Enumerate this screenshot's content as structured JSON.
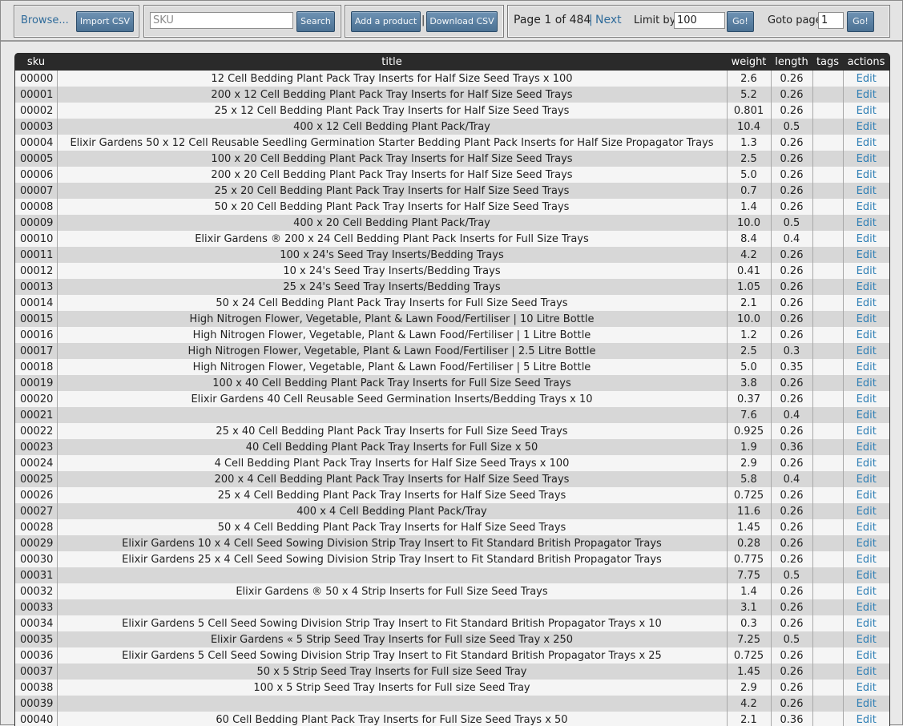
{
  "toolbar": {
    "browse_label": "Browse...",
    "import_label": "Import CSV",
    "sku_placeholder": "SKU",
    "search_label": "Search",
    "add_product_label": "Add a product",
    "separator": "|",
    "download_label": "Download CSV",
    "page_info": "Page 1 of 484",
    "page_sep": "|",
    "next_label": "Next",
    "limit_label": "Limit by",
    "limit_value": "100",
    "limit_go": "Go!",
    "goto_label": "Goto page",
    "goto_value": "1",
    "goto_go": "Go!"
  },
  "table": {
    "headers": [
      "sku",
      "title",
      "weight",
      "length",
      "tags",
      "actions"
    ],
    "action_label": "Edit",
    "rows": [
      [
        "00000",
        "12 Cell Bedding Plant Pack Tray Inserts for Half Size Seed Trays x 100",
        "2.6",
        "0.26",
        ""
      ],
      [
        "00001",
        "200 x 12 Cell Bedding Plant Pack Tray Inserts for Half Size Seed Trays",
        "5.2",
        "0.26",
        ""
      ],
      [
        "00002",
        "25 x 12 Cell Bedding Plant Pack Tray Inserts for Half Size Seed Trays",
        "0.801",
        "0.26",
        ""
      ],
      [
        "00003",
        "400 x 12 Cell Bedding Plant Pack/Tray",
        "10.4",
        "0.5",
        ""
      ],
      [
        "00004",
        "Elixir Gardens 50 x 12 Cell Reusable Seedling Germination Starter Bedding Plant Pack Inserts for Half Size Propagator Trays",
        "1.3",
        "0.26",
        ""
      ],
      [
        "00005",
        "100 x 20 Cell Bedding Plant Pack Tray Inserts for Half Size Seed Trays",
        "2.5",
        "0.26",
        ""
      ],
      [
        "00006",
        "200 x 20 Cell Bedding Plant Pack Tray Inserts for Half Size Seed Trays",
        "5.0",
        "0.26",
        ""
      ],
      [
        "00007",
        "25 x 20 Cell Bedding Plant Pack Tray Inserts for Half Size Seed Trays",
        "0.7",
        "0.26",
        ""
      ],
      [
        "00008",
        "50 x 20 Cell Bedding Plant Pack Tray Inserts for Half Size Seed Trays",
        "1.4",
        "0.26",
        ""
      ],
      [
        "00009",
        "400 x 20 Cell Bedding Plant Pack/Tray",
        "10.0",
        "0.5",
        ""
      ],
      [
        "00010",
        "Elixir Gardens ® 200 x 24 Cell Bedding Plant Pack Inserts for Full Size Trays",
        "8.4",
        "0.4",
        ""
      ],
      [
        "00011",
        "100 x 24's Seed Tray Inserts/Bedding Trays",
        "4.2",
        "0.26",
        ""
      ],
      [
        "00012",
        "10 x 24's Seed Tray Inserts/Bedding Trays",
        "0.41",
        "0.26",
        ""
      ],
      [
        "00013",
        "25 x 24's Seed Tray Inserts/Bedding Trays",
        "1.05",
        "0.26",
        ""
      ],
      [
        "00014",
        "50 x 24 Cell Bedding Plant Pack Tray Inserts for Full Size Seed Trays",
        "2.1",
        "0.26",
        ""
      ],
      [
        "00015",
        "High Nitrogen Flower, Vegetable, Plant & Lawn Food/Fertiliser | 10 Litre Bottle",
        "10.0",
        "0.26",
        ""
      ],
      [
        "00016",
        "High Nitrogen Flower, Vegetable, Plant & Lawn Food/Fertiliser | 1 Litre Bottle",
        "1.2",
        "0.26",
        ""
      ],
      [
        "00017",
        "High Nitrogen Flower, Vegetable, Plant & Lawn Food/Fertiliser | 2.5 Litre Bottle",
        "2.5",
        "0.3",
        ""
      ],
      [
        "00018",
        "High Nitrogen Flower, Vegetable, Plant & Lawn Food/Fertiliser | 5 Litre Bottle",
        "5.0",
        "0.35",
        ""
      ],
      [
        "00019",
        "100 x 40 Cell Bedding Plant Pack Tray Inserts for Full Size Seed Trays",
        "3.8",
        "0.26",
        ""
      ],
      [
        "00020",
        "Elixir Gardens 40 Cell Reusable Seed Germination Inserts/Bedding Trays x 10",
        "0.37",
        "0.26",
        ""
      ],
      [
        "00021",
        "",
        "7.6",
        "0.4",
        ""
      ],
      [
        "00022",
        "25 x 40 Cell Bedding Plant Pack Tray Inserts for Full Size Seed Trays",
        "0.925",
        "0.26",
        ""
      ],
      [
        "00023",
        "40 Cell Bedding Plant Pack Tray Inserts for Full Size x 50",
        "1.9",
        "0.36",
        ""
      ],
      [
        "00024",
        "4 Cell Bedding Plant Pack Tray Inserts for Half Size Seed Trays x 100",
        "2.9",
        "0.26",
        ""
      ],
      [
        "00025",
        "200 x 4 Cell Bedding Plant Pack Tray Inserts for Half Size Seed Trays",
        "5.8",
        "0.4",
        ""
      ],
      [
        "00026",
        "25 x 4 Cell Bedding Plant Pack Tray Inserts for Half Size Seed Trays",
        "0.725",
        "0.26",
        ""
      ],
      [
        "00027",
        "400 x 4 Cell Bedding Plant Pack/Tray",
        "11.6",
        "0.26",
        ""
      ],
      [
        "00028",
        "50 x 4 Cell Bedding Plant Pack Tray Inserts for Half Size Seed Trays",
        "1.45",
        "0.26",
        ""
      ],
      [
        "00029",
        "Elixir Gardens 10 x 4 Cell Seed Sowing Division Strip Tray Insert to Fit Standard British Propagator Trays",
        "0.28",
        "0.26",
        ""
      ],
      [
        "00030",
        "Elixir Gardens 25 x 4 Cell Seed Sowing Division Strip Tray Insert to Fit Standard British Propagator Trays",
        "0.775",
        "0.26",
        ""
      ],
      [
        "00031",
        "",
        "7.75",
        "0.5",
        ""
      ],
      [
        "00032",
        "Elixir Gardens ® 50 x 4 Strip Inserts for Full Size Seed Trays",
        "1.4",
        "0.26",
        ""
      ],
      [
        "00033",
        "",
        "3.1",
        "0.26",
        ""
      ],
      [
        "00034",
        "Elixir Gardens 5 Cell Seed Sowing Division Strip Tray Insert to Fit Standard British Propagator Trays x 10",
        "0.3",
        "0.26",
        ""
      ],
      [
        "00035",
        "Elixir Gardens « 5 Strip Seed Tray Inserts for Full size Seed Tray x 250",
        "7.25",
        "0.5",
        ""
      ],
      [
        "00036",
        "Elixir Gardens 5 Cell Seed Sowing Division Strip Tray Insert to Fit Standard British Propagator Trays x 25",
        "0.725",
        "0.26",
        ""
      ],
      [
        "00037",
        "50 x 5 Strip Seed Tray Inserts for Full size Seed Tray",
        "1.45",
        "0.26",
        ""
      ],
      [
        "00038",
        "100 x 5 Strip Seed Tray Inserts for Full size Seed Tray",
        "2.9",
        "0.26",
        ""
      ],
      [
        "00039",
        "",
        "4.2",
        "0.26",
        ""
      ],
      [
        "00040",
        "60 Cell Bedding Plant Pack Tray Inserts for Full Size Seed Trays x 50",
        "2.1",
        "0.36",
        ""
      ]
    ]
  }
}
